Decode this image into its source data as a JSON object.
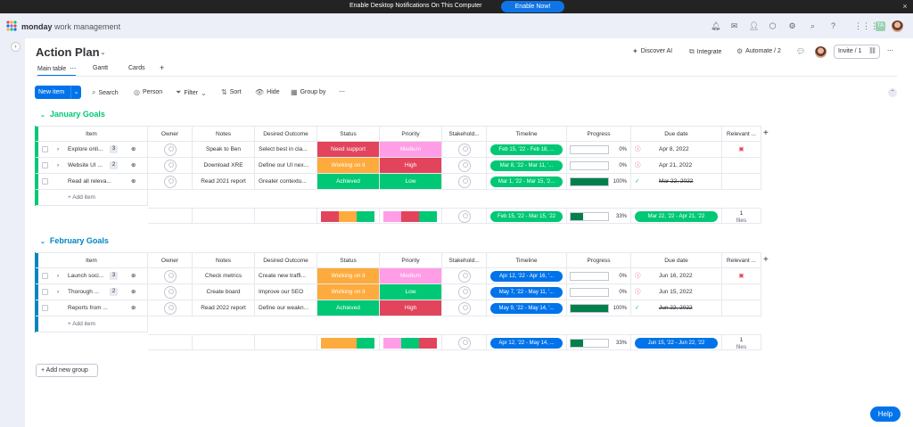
{
  "banner": {
    "text": "Enable Desktop Notifications On This Computer",
    "button": "Enable Now!",
    "close": "×"
  },
  "brand": {
    "name": "monday",
    "suffix": "work management"
  },
  "colors": {
    "accent": "#0073ea",
    "green": "#00c875",
    "red": "#e2445c",
    "orange": "#fdab3d",
    "pink": "#ff9ee6",
    "group1": "#00c875",
    "group2": "#0086c0"
  },
  "board": {
    "title": "Action Plan",
    "tabs": [
      "Main table",
      "Gantt",
      "Cards"
    ],
    "discover": "Discover AI",
    "integrate": "Integrate",
    "automate": "Automate / 2",
    "invite": "Invite / 1"
  },
  "toolbar": {
    "new_item": "New item",
    "search": "Search",
    "person": "Person",
    "filter": "Filter",
    "sort": "Sort",
    "hide": "Hide",
    "group_by": "Group by"
  },
  "columns": [
    "Item",
    "Owner",
    "Notes",
    "Desired Outcome",
    "Status",
    "Priority",
    "Stakehold...",
    "Timeline",
    "Progress",
    "Due date",
    "Relevant ..."
  ],
  "groups": [
    {
      "title": "January Goals",
      "rows": [
        {
          "item": "Explore onli...",
          "count": "3",
          "notes": "Speak to Ben",
          "outcome": "Select best in cla...",
          "status": "Need support",
          "status_color": "#e2445c",
          "priority": "Medium",
          "priority_color": "#ff9ee6",
          "timeline": "Feb 15, '22 - Feb 18, ...",
          "progress": "0%",
          "progress_value": 0,
          "due": "Apr 8, 2022",
          "due_state": "alert",
          "relevant": "doc"
        },
        {
          "item": "Website UI ...",
          "count": "2",
          "notes": "Download XRE",
          "outcome": "Define our UI nex...",
          "status": "Working on it",
          "status_color": "#fdab3d",
          "priority": "High",
          "priority_color": "#e2445c",
          "timeline": "Mar 8, '22 - Mar 11, '...",
          "progress": "0%",
          "progress_value": 0,
          "due": "Apr 21, 2022",
          "due_state": "alert",
          "relevant": ""
        },
        {
          "item": "Read all releva...",
          "count": "",
          "notes": "Read 2021 report",
          "outcome": "Greater contextu...",
          "status": "Achieved",
          "status_color": "#00c875",
          "priority": "Low",
          "priority_color": "#00c875",
          "timeline": "Mar 1, '22 - Mar 15, '2...",
          "progress": "100%",
          "progress_value": 100,
          "due": "Mar 22, 2022",
          "due_state": "done",
          "relevant": ""
        }
      ],
      "add": "+ Add item",
      "summary": {
        "timeline": "Feb 15, '22 - Mar 15, '22",
        "progress": "33%",
        "progress_value": 33,
        "due": "Mar 22, '22 - Apr 21, '22",
        "files": "1",
        "files_label": "files"
      }
    },
    {
      "title": "February Goals",
      "rows": [
        {
          "item": "Launch soci...",
          "count": "3",
          "notes": "Check metrics",
          "outcome": "Create new traffi...",
          "status": "Working on it",
          "status_color": "#fdab3d",
          "priority": "Medium",
          "priority_color": "#ff9ee6",
          "timeline": "Apr 12, '22 - Apr 16, '...",
          "progress": "0%",
          "progress_value": 0,
          "due": "Jun 16, 2022",
          "due_state": "alert",
          "relevant": "doc"
        },
        {
          "item": "Thorough ...",
          "count": "2",
          "notes": "Create board",
          "outcome": "Improve our SEO",
          "status": "Working on it",
          "status_color": "#fdab3d",
          "priority": "Low",
          "priority_color": "#00c875",
          "timeline": "May 7, '22 - May 11, '...",
          "progress": "0%",
          "progress_value": 0,
          "due": "Jun 15, 2022",
          "due_state": "alert",
          "relevant": ""
        },
        {
          "item": "Reports from ...",
          "count": "",
          "notes": "Read 2022 report",
          "outcome": "Define our weakn...",
          "status": "Achieved",
          "status_color": "#00c875",
          "priority": "High",
          "priority_color": "#e2445c",
          "timeline": "May 9, '22 - May 14, '...",
          "progress": "100%",
          "progress_value": 100,
          "due": "Jun 22, 2022",
          "due_state": "done",
          "relevant": ""
        }
      ],
      "add": "+ Add item",
      "summary": {
        "timeline": "Apr 12, '22 - May 14, ...",
        "progress": "33%",
        "progress_value": 33,
        "due": "Jun 15, '22 - Jun 22, '22",
        "files": "1",
        "files_label": "files"
      }
    }
  ],
  "add_group": "Add new group",
  "help": "Help"
}
